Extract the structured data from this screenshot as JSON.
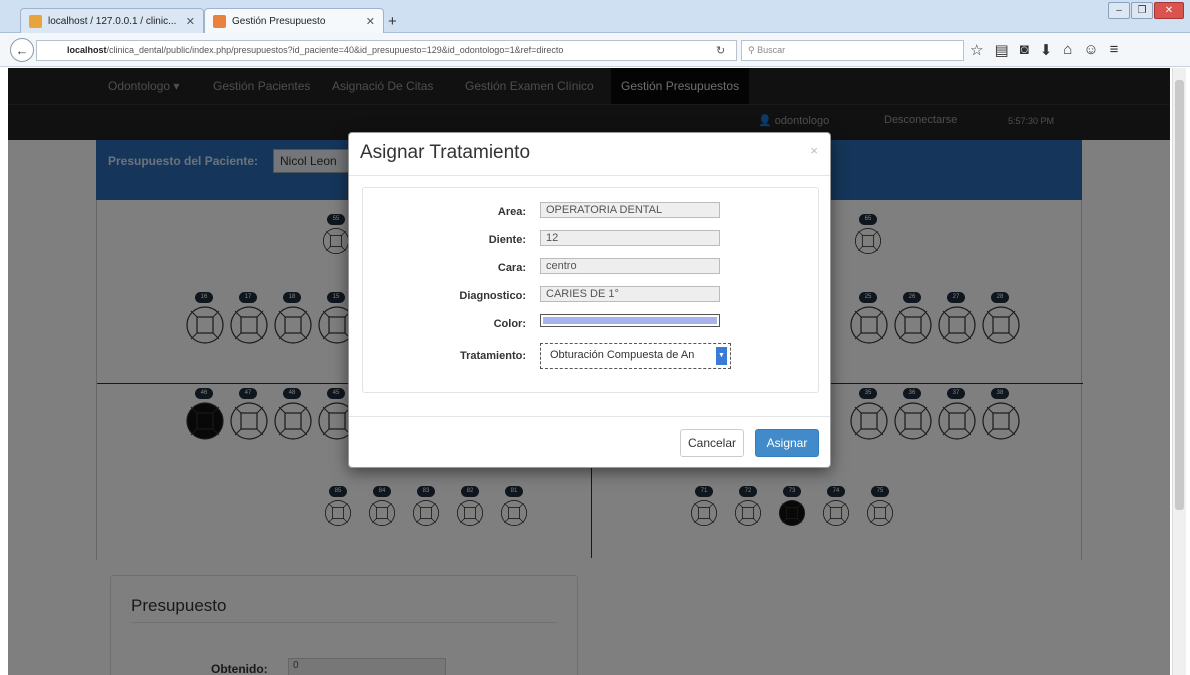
{
  "browser": {
    "tabs": [
      {
        "title": "localhost / 127.0.0.1 / clinic..."
      },
      {
        "title": "Gestión Presupuesto"
      }
    ],
    "url_host": "localhost",
    "url_rest": "/clinica_dental/public/index.php/presupuestos?id_paciente=40&id_presupuesto=129&id_odontologo=1&ref=directo",
    "search_placeholder": "Buscar"
  },
  "appnav": {
    "items": [
      "Odontologo",
      "Gestión Pacientes",
      "Asignació De Citas",
      "Gestión Examen Clínico",
      "Gestión Presupuestos"
    ]
  },
  "subnav": {
    "user": "odontologo",
    "logout": "Desconectarse",
    "time": "5:57:30 PM"
  },
  "panel": {
    "label": "Presupuesto del Paciente:",
    "patient": "Nicol Leon"
  },
  "odontogram": {
    "upper_left_row": [
      "16",
      "17",
      "18",
      "15"
    ],
    "upper_left_single": "55",
    "upper_right_single": "65",
    "upper_right_row": [
      "25",
      "26",
      "27",
      "28"
    ],
    "lower_left_row": [
      "46",
      "47",
      "48",
      "45"
    ],
    "lower_right_row": [
      "35",
      "36",
      "37",
      "38"
    ],
    "child_left": [
      "85",
      "84",
      "83",
      "82",
      "81"
    ],
    "child_right": [
      "71",
      "72",
      "73",
      "74",
      "75"
    ]
  },
  "budget": {
    "title": "Presupuesto",
    "obtained_label": "Obtenido:",
    "obtained_value": "0"
  },
  "modal": {
    "title": "Asignar Tratamiento",
    "close": "×",
    "fields": {
      "area_label": "Area:",
      "area_value": "OPERATORIA DENTAL",
      "diente_label": "Diente:",
      "diente_value": "12",
      "cara_label": "Cara:",
      "cara_value": "centro",
      "diagnostico_label": "Diagnostico:",
      "diagnostico_value": "CARIES DE 1°",
      "color_label": "Color:",
      "color_value": "#a6b3ec",
      "tratamiento_label": "Tratamiento:",
      "tratamiento_value": "Obturación Compuesta de An"
    },
    "cancel": "Cancelar",
    "assign": "Asignar"
  }
}
